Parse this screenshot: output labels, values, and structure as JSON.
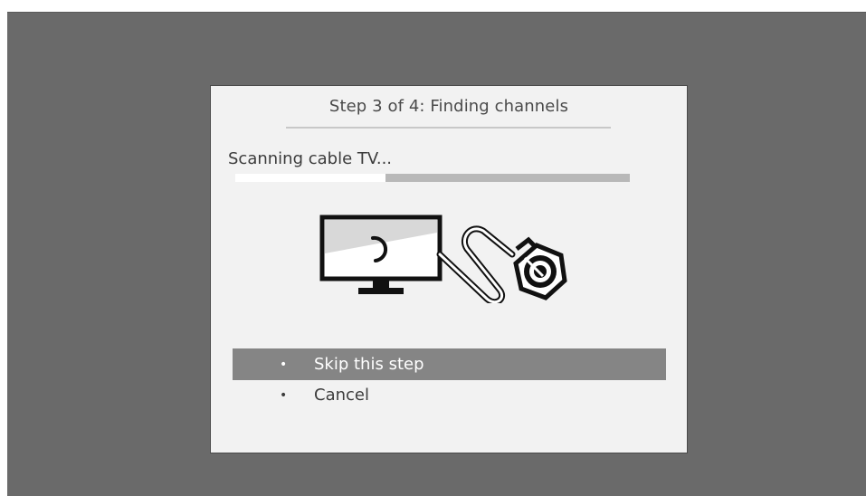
{
  "dialog": {
    "title": "Step 3 of 4: Finding channels",
    "status": "Scanning cable TV...",
    "progress": 0.38
  },
  "illustration": {
    "tv_icon": "tv-monitor-icon",
    "spinner_icon": "loading-spinner-icon",
    "cable_icon": "coaxial-cable-icon"
  },
  "menu": {
    "items": [
      {
        "label": "Skip this step",
        "selected": true
      },
      {
        "label": "Cancel",
        "selected": false
      }
    ]
  },
  "colors": {
    "background": "#6a6a6a",
    "dialog": "#f2f2f2",
    "selected_row": "#858585",
    "progress_track": "#b8b8b8",
    "progress_fill": "#ffffff"
  }
}
